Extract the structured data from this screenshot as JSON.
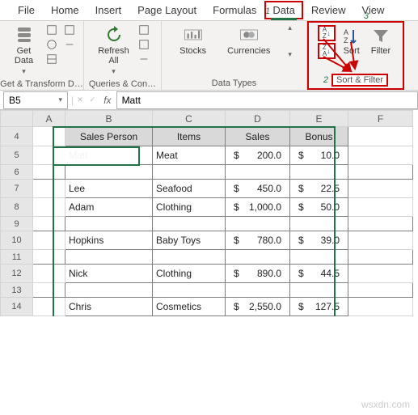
{
  "tabs": {
    "file": "File",
    "home": "Home",
    "insert": "Insert",
    "pagelayout": "Page Layout",
    "formulas": "Formulas",
    "data": "Data",
    "review": "Review",
    "view": "View"
  },
  "ribbon": {
    "getdata": "Get\nData",
    "refresh": "Refresh\nAll",
    "stocks": "Stocks",
    "currencies": "Currencies",
    "sort": "Sort",
    "filter": "Filter",
    "grp_get": "Get & Transform D…",
    "grp_conn": "Queries & Con…",
    "grp_types": "Data Types",
    "grp_sort": "Sort & Filter"
  },
  "annot": {
    "n1": "1",
    "n2": "2",
    "n3": "3"
  },
  "namebox": "B5",
  "fx": "fx",
  "formula": "Matt",
  "cols": {
    "A": "A",
    "B": "B",
    "C": "C",
    "D": "D",
    "E": "E",
    "F": "F"
  },
  "rows": [
    "4",
    "5",
    "6",
    "7",
    "8",
    "9",
    "10",
    "11",
    "12",
    "13",
    "14"
  ],
  "headers": {
    "b": "Sales Person",
    "c": "Items",
    "d": "Sales",
    "e": "Bonus"
  },
  "cur": "$",
  "data": {
    "r5": {
      "b": "Matt",
      "c": "Meat",
      "d": "200.0",
      "e": "10.0"
    },
    "r7": {
      "b": "Lee",
      "c": "Seafood",
      "d": "450.0",
      "e": "22.5"
    },
    "r8": {
      "b": "Adam",
      "c": "Clothing",
      "d": "1,000.0",
      "e": "50.0"
    },
    "r10": {
      "b": "Hopkins",
      "c": "Baby Toys",
      "d": "780.0",
      "e": "39.0"
    },
    "r12": {
      "b": "Nick",
      "c": "Clothing",
      "d": "890.0",
      "e": "44.5"
    },
    "r14": {
      "b": "Chris",
      "c": "Cosmetics",
      "d": "2,550.0",
      "e": "127.5"
    }
  },
  "watermark": "wsxdn.com",
  "sortAZ": "A→Z",
  "sortZA": "Z→A"
}
